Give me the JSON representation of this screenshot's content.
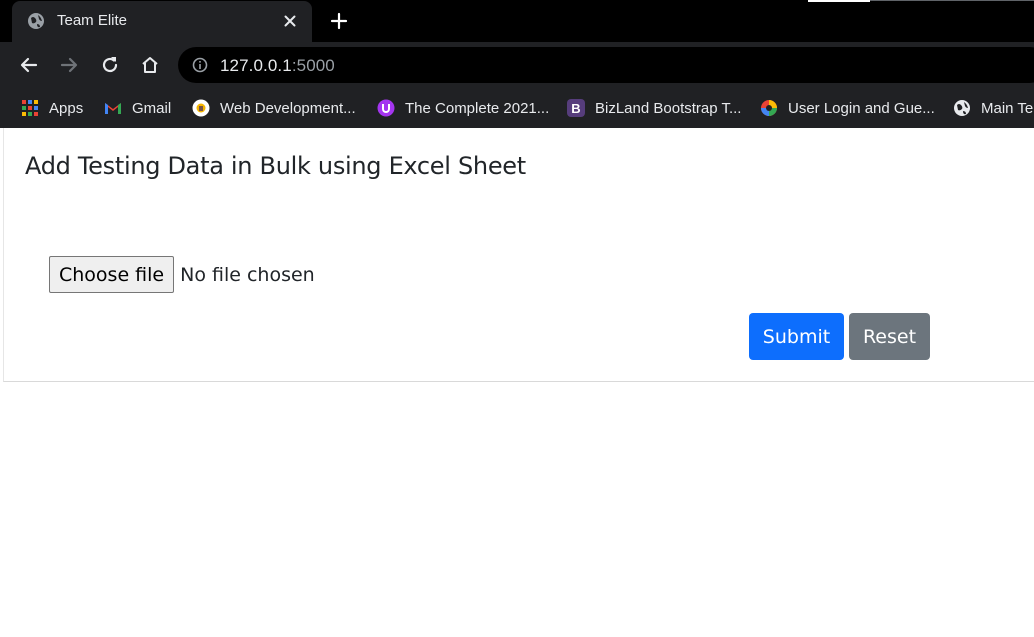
{
  "browser": {
    "tab": {
      "title": "Team Elite"
    },
    "address": {
      "host": "127.0.0.1",
      "port": ":5000"
    },
    "bookmarks": [
      {
        "label": "Apps",
        "icon": "apps-grid-icon"
      },
      {
        "label": "Gmail",
        "icon": "gmail-icon"
      },
      {
        "label": "Web Development...",
        "icon": "web-dev-icon"
      },
      {
        "label": "The Complete 2021...",
        "icon": "udemy-icon"
      },
      {
        "label": "BizLand Bootstrap T...",
        "icon": "bootstrap-icon"
      },
      {
        "label": "User Login and Gue...",
        "icon": "colorful-wheel-icon"
      },
      {
        "label": "Main Te",
        "icon": "globe-icon"
      }
    ]
  },
  "page": {
    "heading": "Add Testing Data in Bulk using Excel Sheet",
    "file_input": {
      "button_label": "Choose file",
      "status": "No file chosen"
    },
    "submit_label": "Submit",
    "reset_label": "Reset"
  },
  "colors": {
    "submit": "#0d6efd",
    "reset": "#6c757d",
    "chrome_dark": "#202124"
  }
}
